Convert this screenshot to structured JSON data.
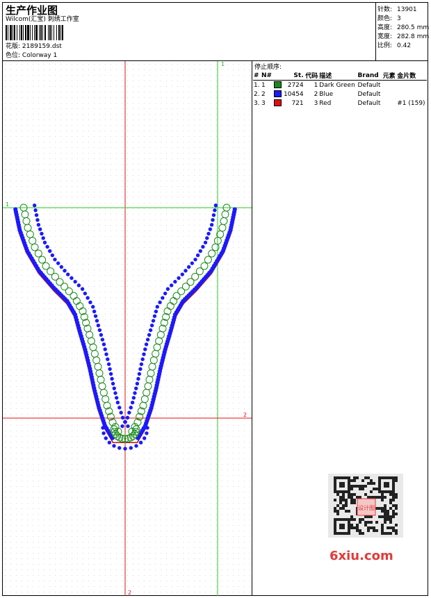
{
  "header": {
    "title": "生产作业图",
    "studio": "Wilcom(汇宝) 刺绣工作室",
    "design_label": "花版:",
    "design_file": "2189159.dst",
    "colorway_label": "色位:",
    "colorway": "Colorway 1"
  },
  "stats": [
    {
      "label": "针数:",
      "value": "13901"
    },
    {
      "label": "颜色:",
      "value": "3"
    },
    {
      "label": "高度:",
      "value": "280.5 mm"
    },
    {
      "label": "宽度:",
      "value": "282.8 mm"
    },
    {
      "label": "比例:",
      "value": "0.42"
    }
  ],
  "stop_sequence": {
    "title": "停止顺序:",
    "columns": [
      "#",
      "N#",
      "St.",
      "代码",
      "描述",
      "Brand",
      "元素",
      "金片数"
    ],
    "rows": [
      {
        "num": "1.",
        "n": "1",
        "color": "#1a8a1a",
        "st": "2724",
        "code": "1",
        "desc": "Dark Green",
        "brand": "Default",
        "elem": "",
        "seq": ""
      },
      {
        "num": "2.",
        "n": "2",
        "color": "#1a1aff",
        "st": "10454",
        "code": "2",
        "desc": "Blue",
        "brand": "Default",
        "elem": "",
        "seq": ""
      },
      {
        "num": "3.",
        "n": "3",
        "color": "#e01010",
        "st": "721",
        "code": "3",
        "desc": "Red",
        "brand": "Default",
        "elem": "",
        "seq": "#1 (159)"
      }
    ]
  },
  "guides": {
    "v1": "1",
    "h1": "1",
    "h2": "2",
    "v2": "2"
  },
  "watermark": {
    "logo": "6xiu.com",
    "seal_text": "设计图"
  }
}
